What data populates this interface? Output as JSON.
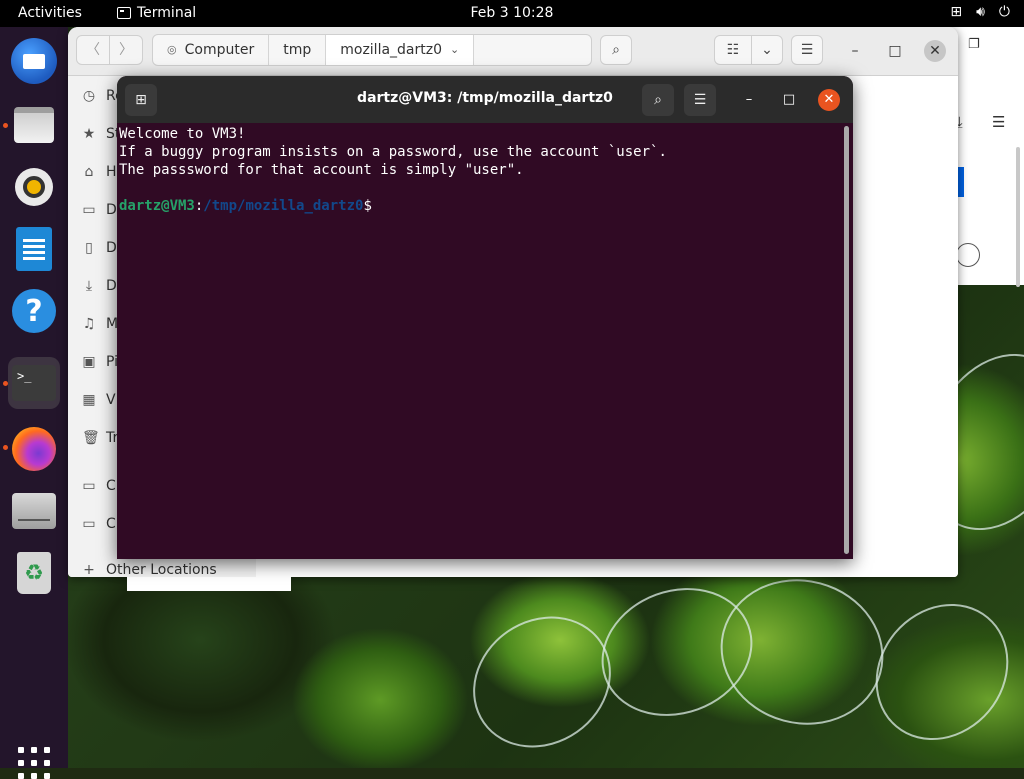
{
  "topbar": {
    "activities": "Activities",
    "app_name": "Terminal",
    "clock": "Feb 3  10:28"
  },
  "dock": {
    "apps": [
      "thunderbird-icon",
      "files-icon",
      "rhythmbox-icon",
      "writer-icon",
      "help-icon",
      "terminal-icon",
      "firefox-icon",
      "drive-icon",
      "trash-icon"
    ]
  },
  "files": {
    "path": [
      "Computer",
      "tmp",
      "mozilla_dartz0"
    ],
    "sidebar": [
      {
        "label": "Re",
        "icon": "recent-icon"
      },
      {
        "label": "St",
        "icon": "starred-icon"
      },
      {
        "label": "H",
        "icon": "home-icon"
      },
      {
        "label": "D",
        "icon": "desktop-icon"
      },
      {
        "label": "D",
        "icon": "documents-icon"
      },
      {
        "label": "D",
        "icon": "downloads-icon"
      },
      {
        "label": "M",
        "icon": "music-icon"
      },
      {
        "label": "Pi",
        "icon": "pictures-icon"
      },
      {
        "label": "V",
        "icon": "videos-icon"
      },
      {
        "label": "Tr",
        "icon": "trash-icon"
      },
      {
        "label": "Cl",
        "icon": "disk-icon"
      },
      {
        "label": "Cl",
        "icon": "disk-icon"
      }
    ],
    "other_locations": "Other Locations"
  },
  "terminal": {
    "title": "dartz@VM3: /tmp/mozilla_dartz0",
    "lines": [
      "Welcome to VM3!",
      "If a buggy program insists on a password, use the account `user`.",
      "The passsword for that account is simply \"user\"."
    ],
    "prompt_user": "dartz@VM3",
    "prompt_sep": ":",
    "prompt_path": "/tmp/mozilla_dartz0",
    "prompt_end": "$"
  }
}
